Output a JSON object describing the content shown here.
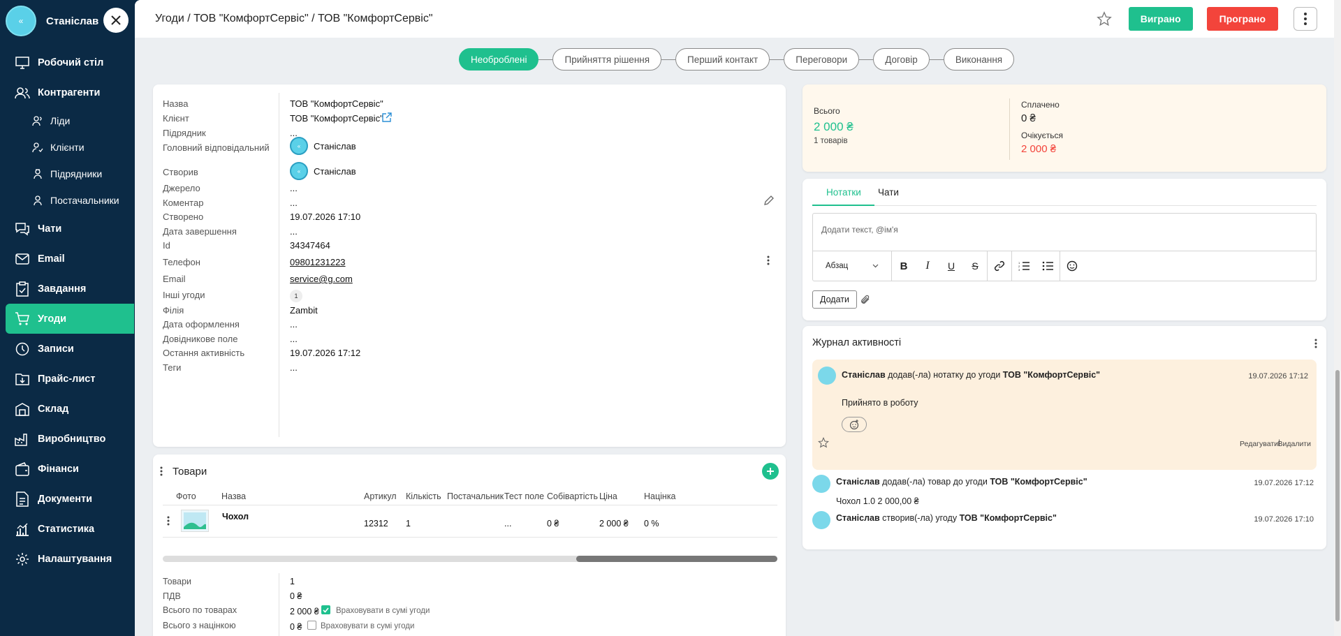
{
  "user": {
    "name": "Станіслав"
  },
  "sidebar": {
    "items": [
      {
        "label": "Робочий стіл",
        "icon": "desktop-icon"
      },
      {
        "label": "Контрагенти",
        "icon": "contacts-icon"
      },
      {
        "label": "Ліди",
        "icon": "lead-icon",
        "sub": true
      },
      {
        "label": "Клієнти",
        "icon": "client-icon",
        "sub": true
      },
      {
        "label": "Підрядники",
        "icon": "contractor-icon",
        "sub": true
      },
      {
        "label": "Постачальники",
        "icon": "supplier-icon",
        "sub": true
      },
      {
        "label": "Чати",
        "icon": "chat-icon"
      },
      {
        "label": "Email",
        "icon": "mail-icon"
      },
      {
        "label": "Завдання",
        "icon": "task-icon"
      },
      {
        "label": "Угоди",
        "icon": "cart-icon",
        "active": true
      },
      {
        "label": "Записи",
        "icon": "clock-icon"
      },
      {
        "label": "Прайс-лист",
        "icon": "pricelist-icon"
      },
      {
        "label": "Склад",
        "icon": "warehouse-icon"
      },
      {
        "label": "Виробництво",
        "icon": "factory-icon"
      },
      {
        "label": "Фінанси",
        "icon": "wallet-icon"
      },
      {
        "label": "Документи",
        "icon": "document-icon"
      },
      {
        "label": "Статистика",
        "icon": "stats-icon"
      },
      {
        "label": "Налаштування",
        "icon": "gear-icon"
      }
    ]
  },
  "header": {
    "breadcrumb": "Угоди / ТОВ \"КомфортСервіс\" / ТОВ \"КомфортСервіс\"",
    "won_label": "Виграно",
    "lost_label": "Програно"
  },
  "stages": [
    "Необроблені",
    "Прийняття рішення",
    "Перший контакт",
    "Переговори",
    "Договір",
    "Виконання"
  ],
  "deal": {
    "fields": [
      {
        "label": "Назва",
        "value": "ТОВ \"КомфортСервіс\""
      },
      {
        "label": "Клієнт",
        "value": "ТОВ \"КомфортСервіс\""
      },
      {
        "label": "Підрядник",
        "value": "..."
      },
      {
        "label": "Головний відповідальний",
        "value": "Станіслав"
      },
      {
        "label": "Створив",
        "value": "Станіслав"
      },
      {
        "label": "Джерело",
        "value": "..."
      },
      {
        "label": "Коментар",
        "value": "..."
      },
      {
        "label": "Створено",
        "value": "19.07.2026 17:10"
      },
      {
        "label": "Дата завершення",
        "value": "..."
      },
      {
        "label": "Id",
        "value": "34347464"
      },
      {
        "label": "Телефон",
        "value": "09801231223"
      },
      {
        "label": "Email",
        "value": "service@g.com"
      },
      {
        "label": "Інші угоди",
        "value": "1"
      },
      {
        "label": "Філія",
        "value": "Zambit"
      },
      {
        "label": "Дата оформлення",
        "value": "..."
      },
      {
        "label": "Довідникове поле",
        "value": "..."
      },
      {
        "label": "Остання активність",
        "value": "19.07.2026 17:12"
      },
      {
        "label": "Теги",
        "value": "..."
      }
    ]
  },
  "goods": {
    "title": "Товари",
    "columns": [
      "Фото",
      "Назва",
      "Артикул",
      "Кількість",
      "Постачальник",
      "Тест поле",
      "Собівартість",
      "Ціна",
      "Націнка"
    ],
    "rows": [
      {
        "name": "Чохол",
        "sku": "12312",
        "qty": "1",
        "supplier": "",
        "test": "...",
        "cost": "0 ₴",
        "price": "2 000 ₴",
        "markup": "0 %"
      }
    ],
    "summary": [
      {
        "label": "Товари",
        "value": "1"
      },
      {
        "label": "ПДВ",
        "value": "0 ₴"
      },
      {
        "label": "Всього по товарах",
        "value": "2 000 ₴",
        "check_label": "Враховувати в сумі угоди"
      },
      {
        "label": "Всього з націнкою",
        "value": "0 ₴",
        "check_label": "Враховувати в сумі угоди"
      }
    ]
  },
  "totals": {
    "total_label": "Всього",
    "total_value": "2 000 ₴",
    "items_count": "1 товарів",
    "paid_label": "Сплачено",
    "paid_value": "0 ₴",
    "expected_label": "Очікується",
    "expected_value": "2 000 ₴"
  },
  "notes": {
    "tabs": [
      "Нотатки",
      "Чати"
    ],
    "placeholder": "Додати текст, @ім'я",
    "format_select": "Абзац",
    "add_label": "Додати"
  },
  "activity": {
    "title": "Журнал активності",
    "entries": [
      {
        "user": "Станіслав",
        "action": "додав(-ла) нотатку до угоди",
        "target": "ТОВ \"КомфортСервіс\"",
        "date": "19.07.2026 17:12",
        "text": "Прийнято в роботу",
        "edit": "Редагувати",
        "delete": "Видалити"
      },
      {
        "user": "Станіслав",
        "action": "додав(-ла) товар до угоди",
        "target": "ТОВ \"КомфортСервіс\"",
        "date": "19.07.2026 17:12",
        "text": "Чохол 1.0 2 000,00 ₴"
      },
      {
        "user": "Станіслав",
        "action": "створив(-ла) угоду",
        "target": "ТОВ \"КомфортСервіс\"",
        "date": "19.07.2026 17:10"
      }
    ]
  },
  "colors": {
    "accent": "#1fc08e",
    "danger": "#f3443b",
    "sidebar": "#0b2a45"
  }
}
